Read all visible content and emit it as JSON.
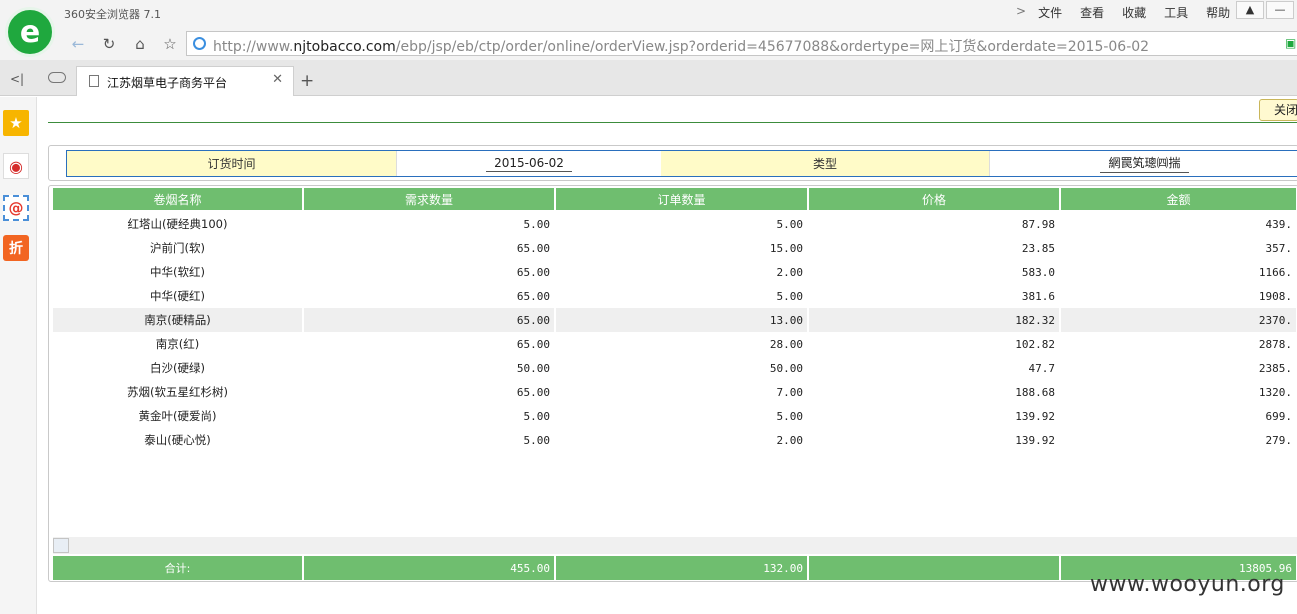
{
  "browser": {
    "title": "360安全浏览器 7.1",
    "menu": [
      "文件",
      "查看",
      "收藏",
      "工具",
      "帮助"
    ],
    "url_prefix": "http://www.",
    "url_domain": "njtobacco.com",
    "url_rest": "/ebp/jsp/eb/ctp/order/online/orderView.jsp?orderid=45677088&ordertype=网上订货&orderdate=2015-06-02",
    "tab_label": "江苏烟草电子商务平台"
  },
  "page": {
    "close_label": "关闭",
    "form": {
      "date_label": "订货时间",
      "date_value": "2015-06-02",
      "type_label": "类型",
      "type_value": "網罠笂璁㈣揣"
    },
    "columns": [
      "卷烟名称",
      "需求数量",
      "订单数量",
      "价格",
      "金额"
    ],
    "rows": [
      {
        "name": "红塔山(硬经典100)",
        "demand": "5.00",
        "order": "5.00",
        "price": "87.98",
        "amount": "439."
      },
      {
        "name": "沪前门(软)",
        "demand": "65.00",
        "order": "15.00",
        "price": "23.85",
        "amount": "357."
      },
      {
        "name": "中华(软红)",
        "demand": "65.00",
        "order": "2.00",
        "price": "583.0",
        "amount": "1166."
      },
      {
        "name": "中华(硬红)",
        "demand": "65.00",
        "order": "5.00",
        "price": "381.6",
        "amount": "1908."
      },
      {
        "name": "南京(硬精品)",
        "demand": "65.00",
        "order": "13.00",
        "price": "182.32",
        "amount": "2370."
      },
      {
        "name": "南京(红)",
        "demand": "65.00",
        "order": "28.00",
        "price": "102.82",
        "amount": "2878."
      },
      {
        "name": "白沙(硬绿)",
        "demand": "50.00",
        "order": "50.00",
        "price": "47.7",
        "amount": "2385."
      },
      {
        "name": "苏烟(软五星红杉树)",
        "demand": "65.00",
        "order": "7.00",
        "price": "188.68",
        "amount": "1320."
      },
      {
        "name": "黄金叶(硬爱尚)",
        "demand": "5.00",
        "order": "5.00",
        "price": "139.92",
        "amount": "699."
      },
      {
        "name": "泰山(硬心悦)",
        "demand": "5.00",
        "order": "2.00",
        "price": "139.92",
        "amount": "279."
      }
    ],
    "highlight_row": 4,
    "footer": {
      "label": "合计:",
      "demand_total": "455.00",
      "order_total": "132.00",
      "price_total": "",
      "amount_total": "13805.96"
    }
  },
  "watermark": "www.wooyun.org",
  "colors": {
    "header_green": "#6fbe6f",
    "label_yellow": "#fffbc8",
    "brand_green": "#1fa83e"
  }
}
